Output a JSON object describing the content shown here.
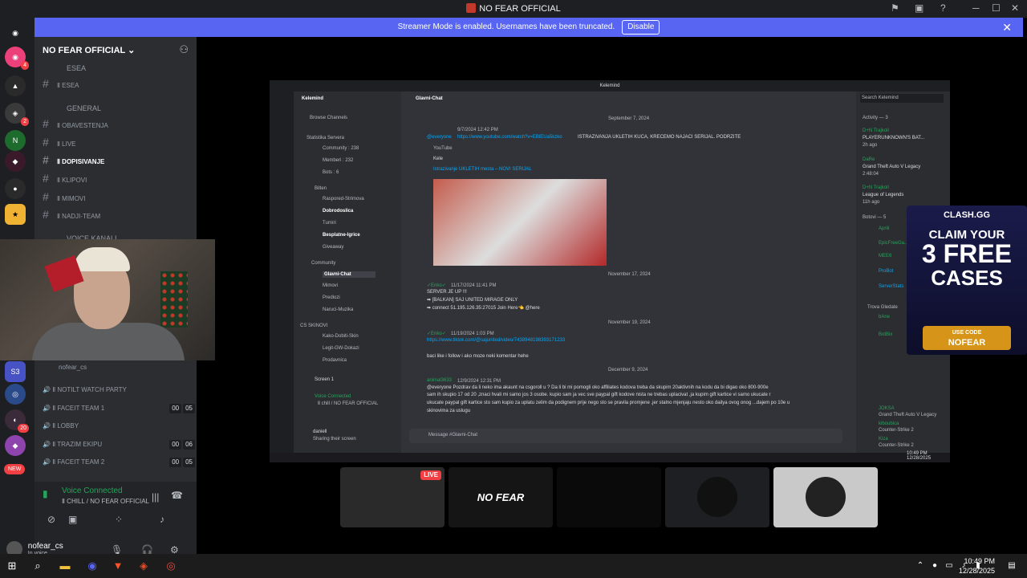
{
  "window": {
    "title": "NO FEAR OFFICIAL"
  },
  "banner": {
    "text": "Streamer Mode is enabled. Usernames have been truncated.",
    "button": "Disable"
  },
  "rail": {
    "badges": [
      "4",
      "2",
      "20"
    ],
    "new_label": "NEW",
    "server_labels": [
      "S3"
    ]
  },
  "server": {
    "name": "NO FEAR OFFICIAL"
  },
  "categories": {
    "esea": "ESEA",
    "general": "GENERAL",
    "voice": "VOICE KANALI"
  },
  "channels": {
    "esea": "Ⅱ ESEA",
    "obavestenja": "Ⅱ OBAVESTENJA",
    "live": "Ⅱ LIVE",
    "dopisivanje": "Ⅱ DOPISIVANJE",
    "klipovi": "Ⅱ KLIPOVI",
    "mimovi": "Ⅱ MIMOVI",
    "nadji": "Ⅱ NADJI-TEAM"
  },
  "voice_channels": [
    {
      "label": "Ⅱ NOTILT WATCH PARTY",
      "tags": []
    },
    {
      "label": "Ⅱ FACEIT TEAM 1",
      "tags": [
        "00",
        "05"
      ]
    },
    {
      "label": "Ⅱ LOBBY",
      "tags": []
    },
    {
      "label": "Ⅱ TRAZIM EKIPU",
      "tags": [
        "00",
        "06"
      ]
    },
    {
      "label": "Ⅱ FACEIT TEAM 2",
      "tags": [
        "00",
        "05"
      ]
    }
  ],
  "voice_user": "nofear_cs",
  "voice_status": {
    "title": "Voice Connected",
    "subtitle": "Ⅱ CHILL / NO FEAR OFFICIAL"
  },
  "user": {
    "name": "nofear_cs",
    "status": "In voice"
  },
  "share": {
    "title": "Kelemind",
    "server": "Kelemind",
    "channel": "Glavni-Chat",
    "search": "Search Kelemind",
    "activity": "Activity — 3",
    "browse": "Browse Channels",
    "stats_cat": "Statistika Servera",
    "stats": [
      "Community : 238",
      "Memberi : 232",
      "Bots : 6"
    ],
    "info_cat": "Bilten",
    "info": [
      "Raspored-Strimova",
      "Dobrodoslica",
      "Turniri",
      "Besplatne-Igrice",
      "Giveaway"
    ],
    "comm_cat": "Community",
    "comm": [
      "Glavni-Chat",
      "Mimovi",
      "Predlozi",
      "Naruci-Muzika"
    ],
    "skin_cat": "CS SKINOVI",
    "skin": [
      "Kako-Dobiti-Skin",
      "Legit-GW-Dokazi",
      "Prodavnica"
    ],
    "screen": "Screen 1",
    "vc": "Voice Connected",
    "vc_sub": "Ⅱ chill / NO FEAR OFFICIAL",
    "me": "daniell",
    "me_sub": "Sharing their screen",
    "date1": "September 7, 2024",
    "msg1_time": "9/7/2024 12:42 PM",
    "msg1_mention": "@everyone",
    "msg1_link": "https://www.youtube.com/watch?v=EBlEUa5kzko",
    "msg1_text": "ISTRAZIVANJA UKLETIH KUCA, KRECEMO NAJACI SERIJAL. PODRZITE",
    "embed_src": "YouTube",
    "embed_author": "Kele",
    "embed_title": "Istrazivanje UKLETIH mesta – NOVI SERIJAL",
    "date2": "November 17, 2024",
    "msg2_author": "✓Enko✓",
    "msg2_time": "11/17/2024 11:41 PM",
    "msg2_lines": [
      "SERVER JE UP !!!",
      "➡ [BALKAN] SAJ UNITED MIRAGE ONLY",
      "➡ connect 51.195.126.35:27015    Join Here👈 @here"
    ],
    "date3": "November 19, 2024",
    "msg3_author": "✓Enko✓",
    "msg3_time": "11/19/2024 1:03 PM",
    "msg3_link": "https://www.tiktok.com/@sajunited/video/7438948198393171233",
    "msg3_text": "baci like i follow i ako moze neki komentar hehe",
    "date4": "December 9, 2024",
    "msg4_author": "animal3633",
    "msg4_time": "12/9/2024 12:31 PM",
    "msg4_lines": [
      "@everyone Pozdrav da li neko ima akaunt na csgoroll u ? Da li bi mi pomogli oko affiliates kodova treba da skupim 20aktivnih na kodu da bi digao oko 800-900e",
      "sam ih skupio 17 od 20 ,znaci hvali mi samo jos 3 osobe. kupio sam ja vec sve paypal gift kodove nista ne trebas uplacivat ,ja kupim gift kartice vi samo ukucate r",
      "ukucate paypal gift kartice sto sam kupio za uplatu zelim da podignem prije nego sto se pravila promjene ,jer stalno mjenjaju nesto oko dailya ovog onog ...dajem po 10e u",
      "skinovima za uslugu"
    ],
    "input": "Message #Glavni-Chat",
    "act": [
      {
        "name": "D+N Trajkoll",
        "game": "PLAYERUNKNOWN'S BAT...",
        "time": "2h ago"
      },
      {
        "name": "DaRe",
        "game": "Grand Theft Auto V Legacy",
        "time": "2:48:04"
      },
      {
        "name": "D+N Trajkoll",
        "game": "League of Legends",
        "time": "11h ago"
      }
    ],
    "bots_cat": "Botovi — 5",
    "bots": [
      "Aprili",
      "EpicFreeGa...",
      "MEE6",
      "ProBot",
      "ServerStats"
    ],
    "trova_cat": "Trova Gledate",
    "members": [
      "bAne",
      "BotBix",
      "JOKSA",
      "kiboubica",
      "Kiza"
    ],
    "member_games": [
      "Counter-Strike 2",
      "Grand Theft Auto V Legacy",
      "Counter-Strike 2",
      "Counter-Strike 2"
    ],
    "clock": "10:49 PM",
    "date": "12/28/2025"
  },
  "ad": {
    "brand": "CLASH.GG",
    "line1": "CLAIM YOUR",
    "line2": "3 FREE",
    "line3": "CASES",
    "code_label": "USE CODE",
    "code": "NOFEAR"
  },
  "tiles": {
    "live_badge": "LIVE",
    "nofear": "NO FEAR"
  },
  "taskbar": {
    "time": "10:49 PM",
    "date": "12/28/2025"
  }
}
